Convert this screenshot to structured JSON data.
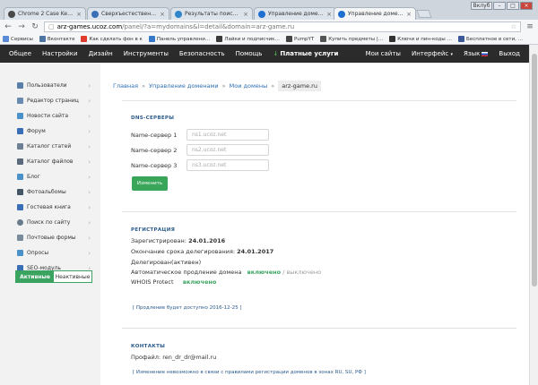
{
  "browser": {
    "tabs": [
      {
        "title": "Chrome 2 Case Key | Mar",
        "color": "#4a4a4a",
        "close": "×"
      },
      {
        "title": "Сверхъестественное 1,2,3",
        "color": "#3a6fb7",
        "close": "×"
      },
      {
        "title": "Результаты поиска «Кин",
        "color": "#2f86c9",
        "close": "×"
      },
      {
        "title": "Управление доменами",
        "color": "#1e6fd1",
        "close": "×"
      },
      {
        "title": "Управление доменами —",
        "color": "#1e6fd1",
        "close": "×"
      }
    ],
    "window_title": "Вклуб",
    "window_controls": [
      "–",
      "□",
      "×"
    ],
    "url_host": "arz-games.ucoz.com",
    "url_path": "/panel/?a=mydomains&l=detail&domain=arz-game.ru",
    "bookmarks": [
      {
        "label": "Сервисы",
        "color": "#5b8bd6"
      },
      {
        "label": "Вконтакте",
        "color": "#4c75a3"
      },
      {
        "label": "Как сделать фон в к",
        "color": "#e03a2c"
      },
      {
        "label": "Панель управлени…",
        "color": "#3579c8"
      },
      {
        "label": "Лайки и подписчик…",
        "color": "#3a3a3a"
      },
      {
        "label": "PumpYT",
        "color": "#444444"
      },
      {
        "label": "Купить предметы |…",
        "color": "#555555"
      },
      {
        "label": "Ключи и пин-коды …",
        "color": "#333333"
      },
      {
        "label": "Бесплатное в сети, …",
        "color": "#3b5998"
      }
    ]
  },
  "topnav": {
    "items": [
      "Общее",
      "Настройки",
      "Дизайн",
      "Инструменты",
      "Безопасность",
      "Помощь"
    ],
    "paid_icon": "↓",
    "paid": "Платные услуги",
    "right": [
      "Мои сайты",
      "Интерфейс",
      "Язык",
      "Выход"
    ]
  },
  "sidebar": {
    "items": [
      "Пользователи",
      "Редактор страниц",
      "Новости сайта",
      "Форум",
      "Каталог статей",
      "Каталог файлов",
      "Блог",
      "Фотоальбомы",
      "Гостевая книга",
      "Поиск по сайту",
      "Почтовые формы",
      "Опросы",
      "SEO-модуль"
    ],
    "toggle_active": "Активные",
    "toggle_inactive": "Неактивные"
  },
  "breadcrumb": {
    "home": "Главная",
    "domains": "Управление доменами",
    "my": "Мои домены",
    "sep": "»",
    "current": "arz-game.ru"
  },
  "dns": {
    "heading": "DNS-СЕРВЕРЫ",
    "rows": [
      {
        "label": "Name-сервер 1",
        "placeholder": "ns1.ucoz.net"
      },
      {
        "label": "Name-сервер 2",
        "placeholder": "ns2.ucoz.net"
      },
      {
        "label": "Name-сервер 3",
        "placeholder": "ns3.ucoz.net"
      }
    ],
    "save": "Изменить"
  },
  "registration": {
    "heading": "РЕГИСТРАЦИЯ",
    "registered_label": "Зарегистрирован:",
    "registered": "24.01.2016",
    "expiry_label": "Окончание срока делегирования:",
    "expiry": "24.01.2017",
    "delegated": "Делегирован(активен)",
    "auto_label": "Автоматическое продление домена",
    "auto_on": "включено",
    "auto_sep": "/",
    "auto_off": "выключено",
    "whois_label": "WHOIS Protect",
    "whois": "включено",
    "note": "[ Продление будет доступно 2016-12-25 ]"
  },
  "contacts": {
    "heading": "КОНТАКТЫ",
    "profile_label": "Профайл:",
    "profile": "ren_dr_dr@mail.ru",
    "note": "[ Изменение невозможно в связи с правилами регистрации доменов в зонах RU, SU, РФ ]"
  }
}
